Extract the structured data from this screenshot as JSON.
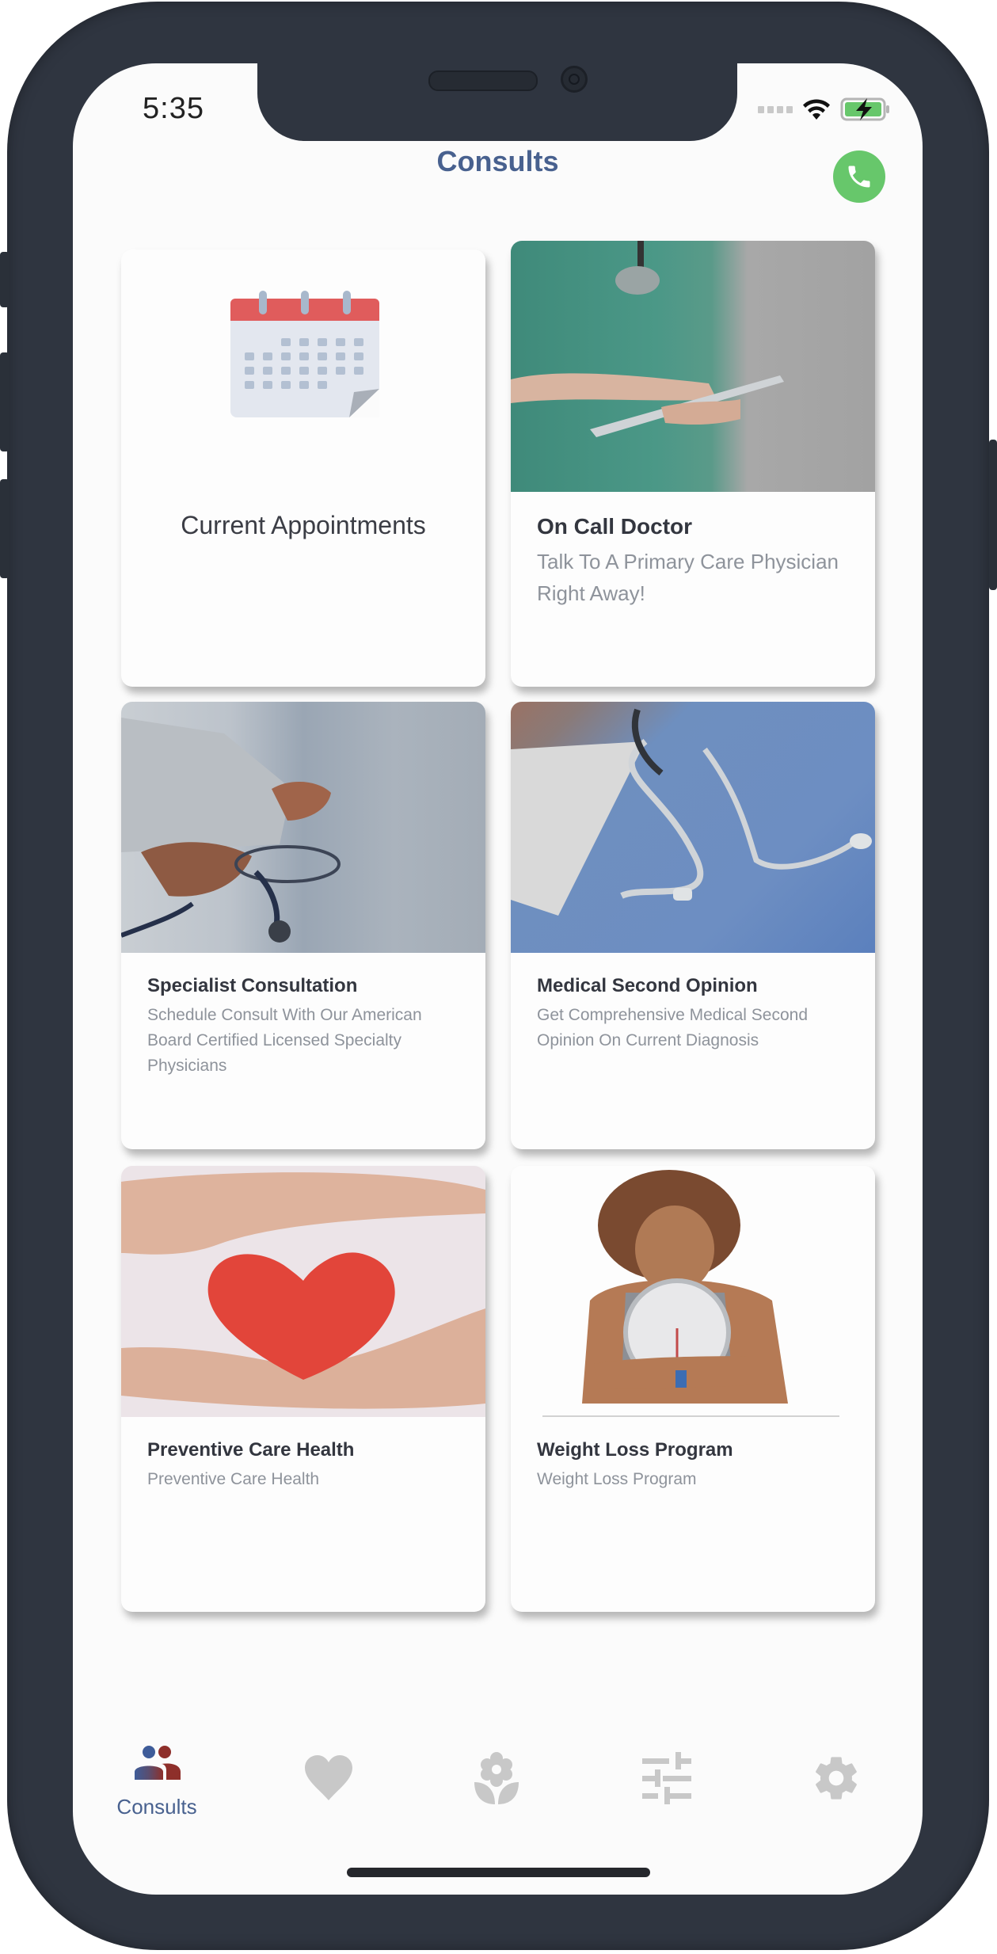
{
  "status_bar": {
    "time": "5:35",
    "signal_icon": "cellular-signal-icon",
    "wifi_icon": "wifi-icon",
    "battery_icon": "battery-charging-icon"
  },
  "header": {
    "title": "Consults",
    "call_button_icon": "phone-icon"
  },
  "colors": {
    "brand": "#48618f",
    "call_green": "#67c76b",
    "inactive_icon": "#c8c8c8",
    "title_text": "#33363f",
    "subtitle_text": "#8e939b"
  },
  "cards": [
    {
      "title": "Current Appointments",
      "subtitle": "",
      "image": "calendar-icon"
    },
    {
      "title": "On Call Doctor",
      "subtitle": "Talk To A Primary Care Physician Right Away!",
      "image": "doctor-with-tablet-photo"
    },
    {
      "title": "Specialist Consultation",
      "subtitle": "Schedule Consult With Our American Board Certified Licensed Specialty Physicians",
      "image": "doctor-with-stethoscope-photo"
    },
    {
      "title": "Medical Second Opinion",
      "subtitle": "Get Comprehensive Medical Second Opinion On Current Diagnosis",
      "image": "stethoscope-on-scrubs-photo"
    },
    {
      "title": "Preventive Care Health",
      "subtitle": "Preventive Care Health",
      "image": "hands-holding-heart-photo"
    },
    {
      "title": "Weight Loss Program",
      "subtitle": "Weight Loss Program",
      "image": "woman-hugging-scale-photo"
    }
  ],
  "tab_bar": {
    "active_index": 0,
    "tabs": [
      {
        "label": "Consults",
        "icon": "people-icon"
      },
      {
        "label": "",
        "icon": "heart-icon"
      },
      {
        "label": "",
        "icon": "flower-icon"
      },
      {
        "label": "",
        "icon": "sliders-icon"
      },
      {
        "label": "",
        "icon": "gear-icon"
      }
    ]
  }
}
